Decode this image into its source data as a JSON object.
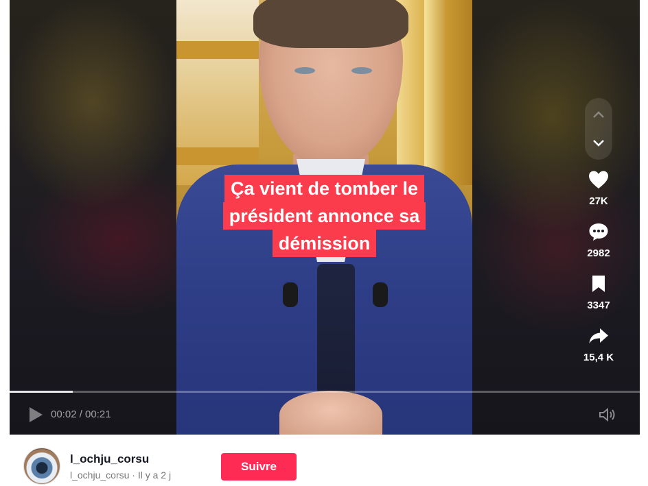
{
  "video": {
    "caption_lines": [
      "Ça vient de tomber le",
      "président annonce sa",
      "démission"
    ],
    "progress_percent": 10
  },
  "actions": {
    "like_count": "27K",
    "comment_count": "2982",
    "save_count": "3347",
    "share_count": "15,4 K"
  },
  "controls": {
    "time": "00:02 / 00:21"
  },
  "author": {
    "username": "l_ochju_corsu",
    "handle": "l_ochju_corsu",
    "separator": "·",
    "posted": "Il y a 2 j",
    "follow_label": "Suivre"
  },
  "colors": {
    "caption_bg": "#fa3c4c",
    "follow_bg": "#fe2c55"
  },
  "icons": {
    "nav_up": "chevron-up-icon",
    "nav_down": "chevron-down-icon",
    "like": "heart-icon",
    "comment": "comment-bubble-icon",
    "save": "bookmark-icon",
    "share": "share-arrow-icon",
    "play": "play-icon",
    "volume": "volume-icon"
  }
}
